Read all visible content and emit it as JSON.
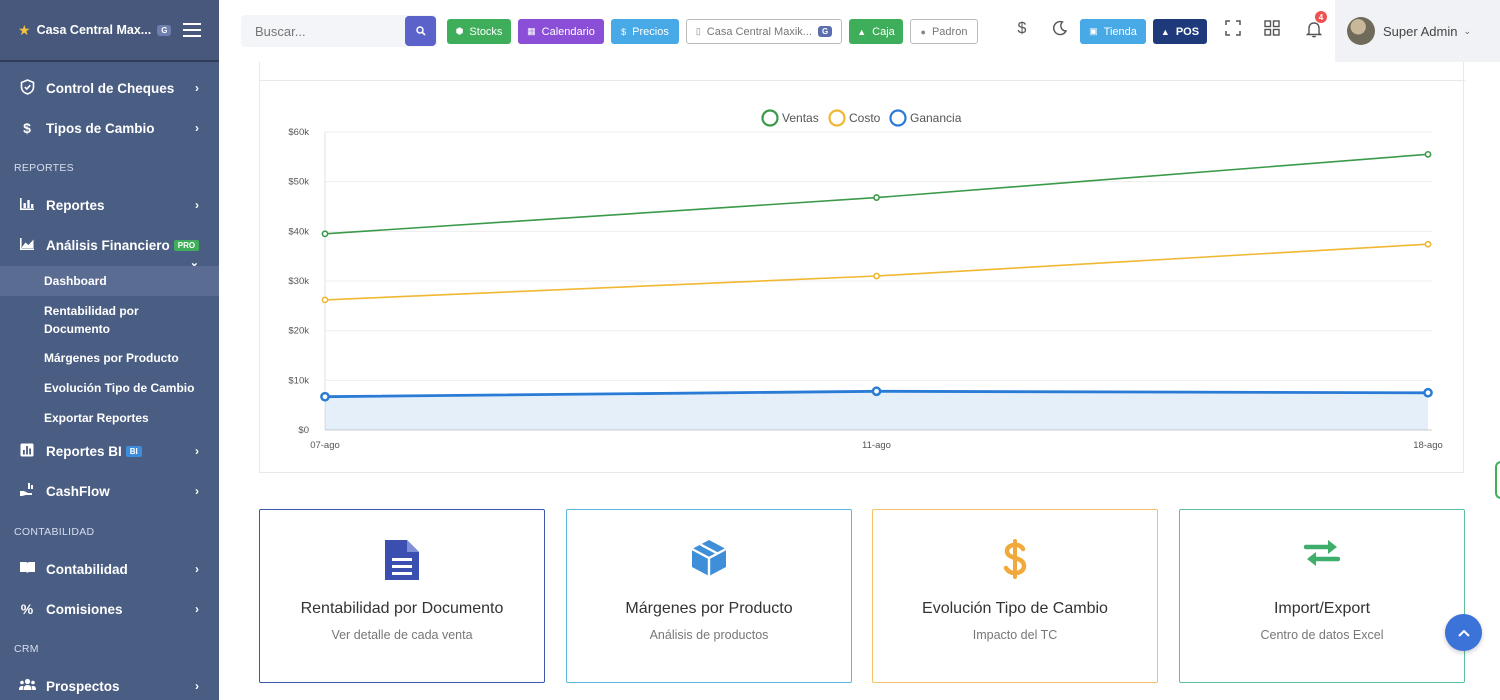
{
  "sidebar": {
    "brand": "Casa Central Max...",
    "brand_badge": "G",
    "items": [
      {
        "label": "Control de Cheques"
      },
      {
        "label": "Tipos de Cambio"
      },
      {
        "label": "Reportes"
      },
      {
        "label": "Análisis Financiero",
        "badge": "PRO"
      },
      {
        "label": "Reportes BI",
        "badge": "BI"
      },
      {
        "label": "CashFlow"
      },
      {
        "label": "Contabilidad"
      },
      {
        "label": "Comisiones"
      },
      {
        "label": "Prospectos"
      }
    ],
    "sections": [
      "REPORTES",
      "CONTABILIDAD",
      "CRM"
    ],
    "subitems": [
      "Dashboard",
      "Rentabilidad por Documento",
      "Márgenes por Producto",
      "Evolución Tipo de Cambio",
      "Exportar Reportes"
    ],
    "active_subitem": "Dashboard"
  },
  "topbar": {
    "search_placeholder": "Buscar...",
    "buttons": [
      {
        "label": "Stocks",
        "color": "#3fae5a"
      },
      {
        "label": "Calendario",
        "color": "#8a4fd6"
      },
      {
        "label": "Precios",
        "color": "#47a9e6"
      },
      {
        "label": "Casa Central Maxik...",
        "badge": "G"
      },
      {
        "label": "Caja",
        "color": "#3fae5a"
      },
      {
        "label": "Padron"
      },
      {
        "label": "Tienda",
        "color": "#47a9e6"
      },
      {
        "label": "POS",
        "color": "#1f3a7a"
      }
    ],
    "currency_symbol": "$",
    "notification_count": "4",
    "user_name": "Super Admin"
  },
  "chart_data": {
    "type": "line",
    "categories": [
      "07-ago",
      "11-ago",
      "18-ago"
    ],
    "series": [
      {
        "name": "Ventas",
        "values": [
          39500,
          46800,
          55500
        ],
        "color": "#3a9a4a"
      },
      {
        "name": "Costo",
        "values": [
          26200,
          31000,
          37400
        ],
        "color": "#f0b733"
      },
      {
        "name": "Ganancia",
        "values": [
          6700,
          7800,
          7500
        ],
        "color": "#2a7bd6",
        "fill": true
      }
    ],
    "ylim": [
      0,
      60000
    ],
    "yticks": [
      "$0",
      "$10k",
      "$20k",
      "$30k",
      "$40k",
      "$50k",
      "$60k"
    ],
    "grid": true,
    "legend": "top-center"
  },
  "cards": [
    {
      "title": "Rentabilidad por Documento",
      "subtitle": "Ver detalle de cada venta",
      "icon": "document-icon",
      "border": "#3a5aa8",
      "icon_color": "#3a4fb0"
    },
    {
      "title": "Márgenes por Producto",
      "subtitle": "Análisis de productos",
      "icon": "box-icon",
      "border": "#5bb8e0",
      "icon_color": "#3f8fd8"
    },
    {
      "title": "Evolución Tipo de Cambio",
      "subtitle": "Impacto del TC",
      "icon": "dollar-icon",
      "border": "#f5c26b",
      "icon_color": "#f0a93a"
    },
    {
      "title": "Import/Export",
      "subtitle": "Centro de datos Excel",
      "icon": "exchange-icon",
      "border": "#5cc0a0",
      "icon_color": "#3fae6a"
    }
  ]
}
